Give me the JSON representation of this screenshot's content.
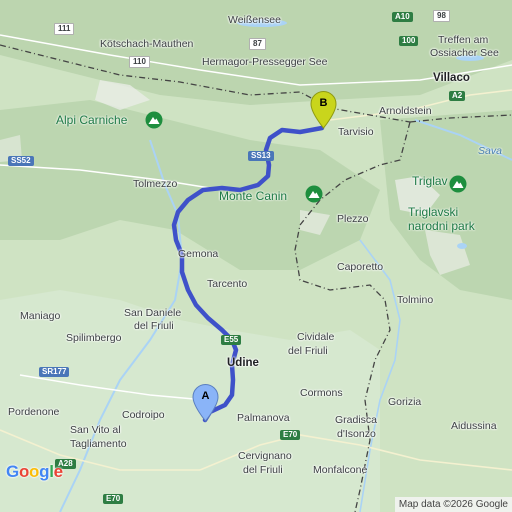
{
  "map": {
    "colors": {
      "land": "#cfe3c3",
      "plain": "#d6e8cf",
      "mountain": "#b9d3ad",
      "peak": "#e9ece6",
      "route": "#3f51c9",
      "border": "#444444",
      "water": "#aad3f5",
      "marker_a": "#8ab4f8",
      "marker_b": "#c9d51c",
      "park_icon": "#1e8e3e"
    },
    "labels": {
      "weissensee": "Weißensee",
      "kotschach": "Kötschach-Mauthen",
      "hermagor": "Hermagor-Pressegger See",
      "treffen": "Treffen am",
      "ossiacher": "Ossiacher See",
      "villaco": "Villaco",
      "arnoldstein": "Arnoldstein",
      "tarvisio": "Tarvisio",
      "alpi_carniche": "Alpi Carniche",
      "sava": "Sava",
      "triglav": "Triglav",
      "tolmezzo": "Tolmezzo",
      "monte_canin": "Monte Canin",
      "plezzo": "Plezzo",
      "triglavski_1": "Triglavski",
      "triglavski_2": "narodni park",
      "gemona": "Gemona",
      "caporetto": "Caporetto",
      "tarcento": "Tarcento",
      "tolmino": "Tolmino",
      "maniago": "Maniago",
      "san_daniele_1": "San Daniele",
      "san_daniele_2": "del Friuli",
      "spilimbergo": "Spilimbergo",
      "cividale_1": "Cividale",
      "cividale_2": "del Friuli",
      "udine": "Udine",
      "pordenone": "Pordenone",
      "codroipo": "Codroipo",
      "cormons": "Cormons",
      "gorizia": "Gorizia",
      "san_vito_1": "San Vito al",
      "san_vito_2": "Tagliamento",
      "palmanova": "Palmanova",
      "gradisca_1": "Gradisca",
      "gradisca_2": "d'Isonzo",
      "aidussina": "Aidussina",
      "cervignano_1": "Cervignano",
      "cervignano_2": "del Friuli",
      "monfalcone": "Monfalcone"
    },
    "shields": {
      "r111": "111",
      "a10": "A10",
      "r98": "98",
      "r87": "87",
      "r100": "100",
      "r110": "110",
      "a2": "A2",
      "ss13": "SS13",
      "ss52": "SS52",
      "e55": "E55",
      "sr177": "SR177",
      "a28": "A28",
      "e70_a": "E70",
      "e70_b": "E70"
    },
    "markers": {
      "start": "A",
      "end": "B"
    }
  },
  "footer": {
    "logo": "Google",
    "attribution": "Map data ©2026 Google"
  }
}
